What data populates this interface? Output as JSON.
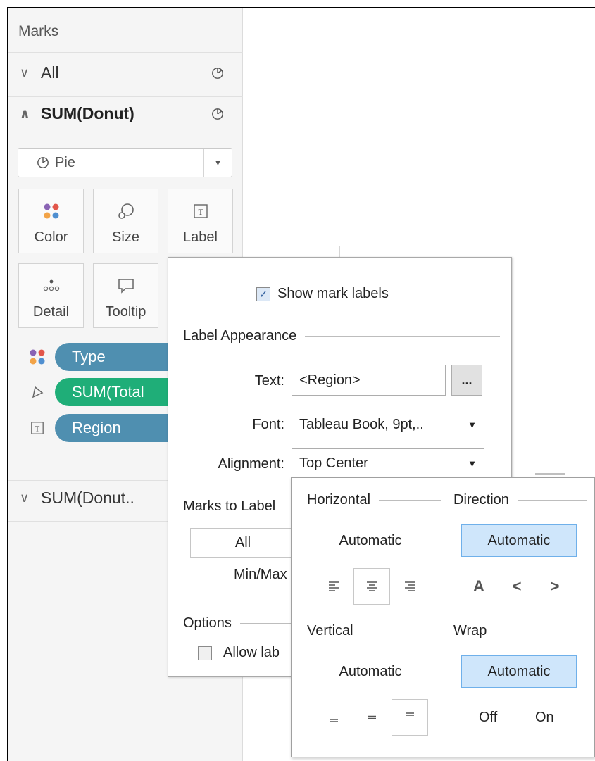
{
  "marks_pane": {
    "title": "Marks",
    "cards": [
      {
        "label": "All",
        "expanded": false,
        "icon": "pie-icon"
      },
      {
        "label": "SUM(Donut)",
        "expanded": true,
        "icon": "pie-icon"
      },
      {
        "label": "SUM(Donut..",
        "expanded": false
      }
    ],
    "mark_type": {
      "label": "Pie",
      "icon": "pie-icon"
    },
    "buttons": [
      {
        "label": "Color",
        "icon": "color-dots-icon"
      },
      {
        "label": "Size",
        "icon": "size-icon"
      },
      {
        "label": "Label",
        "icon": "text-box-icon"
      },
      {
        "label": "Detail",
        "icon": "detail-dots-icon"
      },
      {
        "label": "Tooltip",
        "icon": "speech-bubble-icon"
      }
    ],
    "pills": [
      {
        "label": "Type",
        "icon": "color-dots-icon",
        "color": "#4f8fb0"
      },
      {
        "label": "SUM(Total",
        "icon": "size-icon",
        "color": "#1fae78"
      },
      {
        "label": "Region",
        "icon": "text-box-icon",
        "color": "#4f8fb0"
      }
    ]
  },
  "label_popup": {
    "show_mark_labels": {
      "label": "Show mark labels",
      "checked": true
    },
    "appearance_heading": "Label Appearance",
    "text": {
      "label": "Text:",
      "value": "<Region>",
      "more": "..."
    },
    "font": {
      "label": "Font:",
      "value": "Tableau Book, 9pt,.."
    },
    "alignment": {
      "label": "Alignment:",
      "value": "Top Center"
    },
    "marks_to_label_heading": "Marks to Label",
    "marks_to_label_option": "All",
    "minmax_label": "Min/Max",
    "options_heading": "Options",
    "allow_label": {
      "label": "Allow lab",
      "checked": false
    }
  },
  "alignment_popup": {
    "horizontal": {
      "heading": "Horizontal",
      "value": "Automatic",
      "selected": false,
      "icons": [
        "align-left-icon",
        "align-center-icon",
        "align-right-icon"
      ],
      "selected_icon": 1
    },
    "direction": {
      "heading": "Direction",
      "value": "Automatic",
      "selected": true,
      "glyphs": [
        "A",
        "<",
        ">"
      ]
    },
    "vertical": {
      "heading": "Vertical",
      "value": "Automatic",
      "selected": false,
      "icons": [
        "align-bottom-icon",
        "align-middle-icon",
        "align-top-icon"
      ],
      "selected_icon": 2
    },
    "wrap": {
      "heading": "Wrap",
      "value": "Automatic",
      "selected": true,
      "off": "Off",
      "on": "On"
    }
  },
  "colors": {
    "pill_blue": "#4f8fb0",
    "pill_green": "#1fae78",
    "selected_bg": "#cfe6fb",
    "selected_border": "#6fb0ea"
  }
}
